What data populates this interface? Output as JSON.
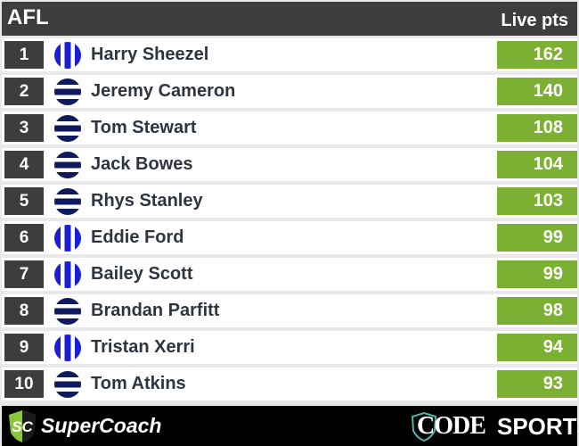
{
  "header": {
    "title": "AFL",
    "column_label": "Live pts"
  },
  "players": [
    {
      "rank": "1",
      "name": "Harry Sheezel",
      "pts": "162",
      "logo": "vertical-stripes"
    },
    {
      "rank": "2",
      "name": "Jeremy Cameron",
      "pts": "140",
      "logo": "horizontal-stripes"
    },
    {
      "rank": "3",
      "name": "Tom Stewart",
      "pts": "108",
      "logo": "horizontal-stripes"
    },
    {
      "rank": "4",
      "name": "Jack Bowes",
      "pts": "104",
      "logo": "horizontal-stripes"
    },
    {
      "rank": "5",
      "name": "Rhys Stanley",
      "pts": "103",
      "logo": "horizontal-stripes"
    },
    {
      "rank": "6",
      "name": "Eddie Ford",
      "pts": "99",
      "logo": "vertical-stripes"
    },
    {
      "rank": "7",
      "name": "Bailey Scott",
      "pts": "99",
      "logo": "vertical-stripes"
    },
    {
      "rank": "8",
      "name": "Brandan Parfitt",
      "pts": "98",
      "logo": "horizontal-stripes"
    },
    {
      "rank": "9",
      "name": "Tristan Xerri",
      "pts": "94",
      "logo": "vertical-stripes"
    },
    {
      "rank": "10",
      "name": "Tom Atkins",
      "pts": "93",
      "logo": "horizontal-stripes"
    }
  ],
  "footer": {
    "left_brand": "SuperCoach",
    "left_brand_mark": "SC",
    "right_brand_1": "CODE",
    "right_brand_2": "SPORTS"
  },
  "colors": {
    "accent_green": "#7cb033",
    "dark": "#3d3d3d",
    "north_blue": "#1a1fd6",
    "geelong_navy": "#0e1a5c"
  }
}
